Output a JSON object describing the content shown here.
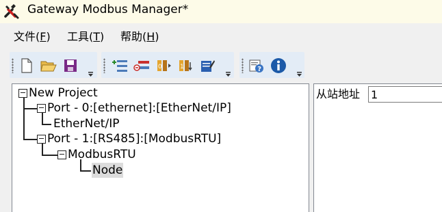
{
  "window": {
    "title": "Gateway Modbus Manager*",
    "app_icon": "wrench-tools-icon"
  },
  "menu": [
    {
      "label": "文件(",
      "accel": "F",
      "suffix": ")"
    },
    {
      "label": "工具(",
      "accel": "T",
      "suffix": ")"
    },
    {
      "label": "帮助(",
      "accel": "H",
      "suffix": ")"
    }
  ],
  "toolbar": {
    "groups": [
      {
        "buttons": [
          "new-file-icon",
          "open-folder-icon",
          "save-icon"
        ]
      },
      {
        "buttons": [
          "add-port-icon",
          "delete-port-icon",
          "modbus-read-icon",
          "modbus-write-icon",
          "edit-icon"
        ]
      },
      {
        "buttons": [
          "help-document-icon",
          "info-icon"
        ]
      }
    ]
  },
  "tree": {
    "root": "New Project",
    "ports": [
      {
        "label": "Port - 0:[ethernet]:[EtherNet/IP]",
        "children": [
          "EtherNet/IP"
        ]
      },
      {
        "label": "Port - 1:[RS485]:[ModbusRTU]",
        "child": "ModbusRTU",
        "leaf": "Node"
      }
    ]
  },
  "properties": {
    "slave_address_label": "从站地址",
    "slave_address_value": "1"
  }
}
